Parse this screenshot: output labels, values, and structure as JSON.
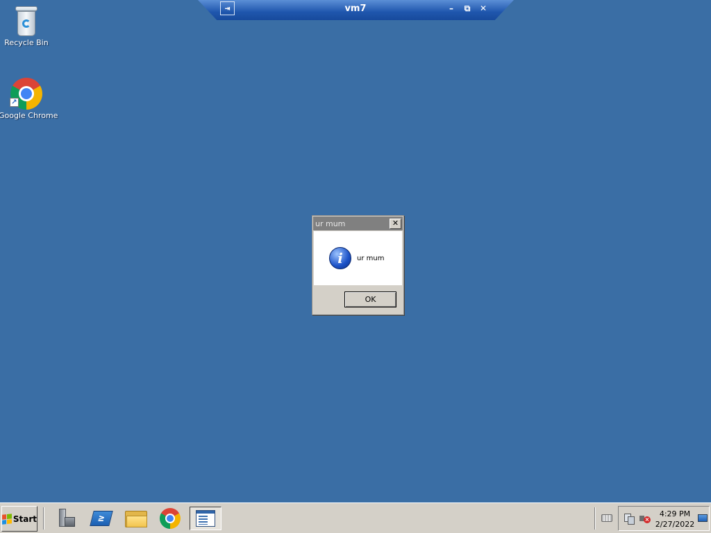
{
  "rdp_bar": {
    "title": "vm7",
    "pin_symbol": "⇥",
    "minimize_symbol": "–",
    "restore_symbol": "⧉",
    "close_symbol": "✕"
  },
  "desktop_icons": [
    {
      "label": "Recycle Bin",
      "icon": "recycle-bin-icon"
    },
    {
      "label": "Google Chrome",
      "icon": "chrome-icon"
    }
  ],
  "message_box": {
    "title": "ur mum",
    "message": "ur mum",
    "icon": "info-icon",
    "icon_glyph": "i",
    "close_symbol": "✕",
    "ok_label": "OK"
  },
  "taskbar": {
    "start_label": "Start",
    "pinned": [
      "server-manager-icon",
      "powershell-icon",
      "file-explorer-icon",
      "chrome-icon",
      "app-window-icon"
    ],
    "powershell_glyph": "≥",
    "clock_time": "4:29 PM",
    "clock_date": "2/27/2022"
  },
  "colors": {
    "desktop": "#3a6ea5",
    "taskbar": "#d4d0c8",
    "dialog_title": "#808080"
  }
}
